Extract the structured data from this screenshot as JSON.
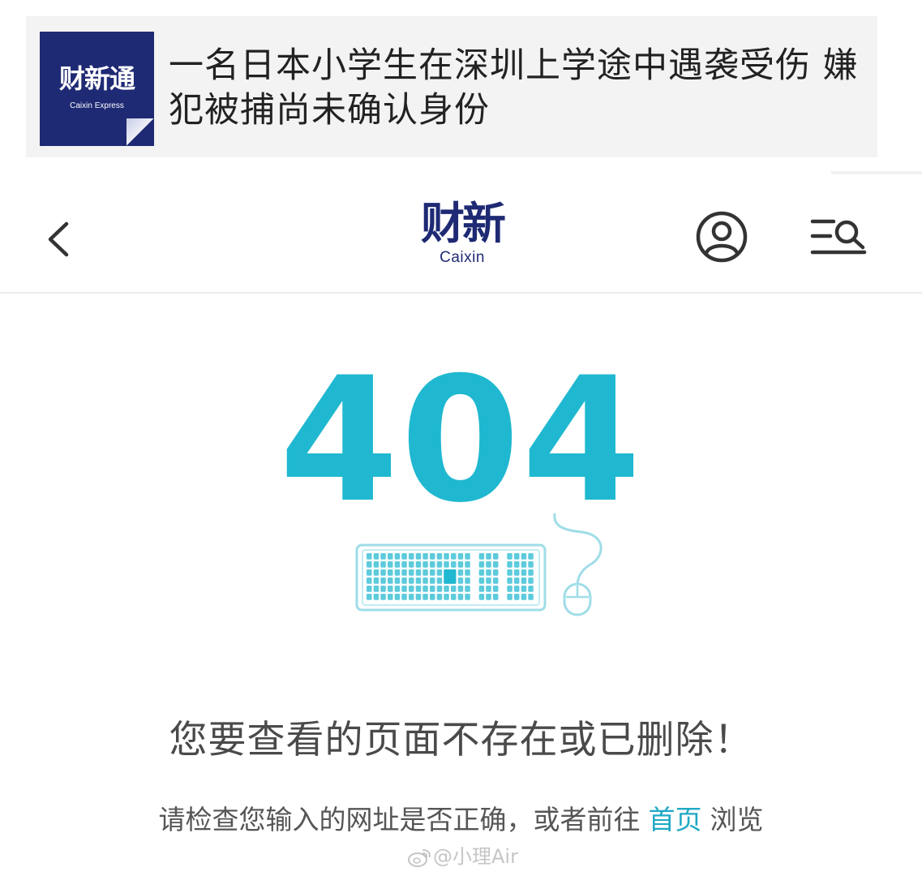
{
  "share_card": {
    "logo_text": "财新通",
    "logo_subtext": "Caixin Express",
    "headline": "一名日本小学生在深圳上学途中遇袭受伤 嫌犯被捕尚未确认身份"
  },
  "header": {
    "brand_cn": "财新",
    "brand_en": "Caixin"
  },
  "error": {
    "code": "404",
    "title": "您要查看的页面不存在或已删除！",
    "hint_before": "请检查您输入的网址是否正确，或者前往",
    "home_link": "首页",
    "hint_after": "浏览"
  },
  "watermark": {
    "text": "@小理Air"
  },
  "icons": {
    "back": "chevron-left-icon",
    "user": "user-circle-icon",
    "menu": "menu-search-icon",
    "illustration": "keyboard-mouse-icon",
    "watermark": "weibo-icon"
  },
  "colors": {
    "brand_navy": "#1f2a74",
    "accent_teal": "#1fb8d0",
    "link_teal": "#1fa9c3",
    "title_gray": "#4a4a4a",
    "card_bg": "#f3f3f3"
  }
}
